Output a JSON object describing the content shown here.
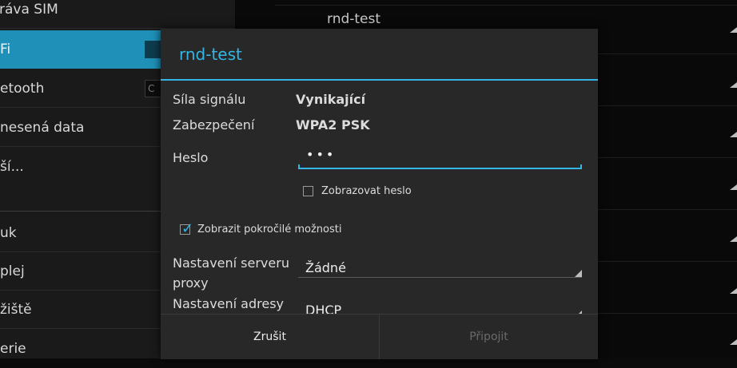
{
  "settings_list": {
    "items": [
      {
        "label": "ráva SIM",
        "toggle": ""
      },
      {
        "label": "Fi",
        "toggle": ""
      },
      {
        "label": "etooth",
        "toggle": "C"
      },
      {
        "label": "nesená data",
        "toggle": ""
      },
      {
        "label": "ší...",
        "toggle": ""
      },
      {
        "label": "uk",
        "toggle": ""
      },
      {
        "label": "plej",
        "toggle": ""
      },
      {
        "label": "žiště",
        "toggle": ""
      },
      {
        "label": "erie",
        "toggle": ""
      }
    ]
  },
  "wifi_list": {
    "network_name": "rnd-test"
  },
  "dialog": {
    "title": "rnd-test",
    "signal_label": "Síla signálu",
    "signal_value": "Vynikající",
    "security_label": "Zabezpečení",
    "security_value": "WPA2 PSK",
    "password_label": "Heslo",
    "password_value": "•••",
    "show_password_label": "Zobrazovat heslo",
    "show_password_checked": false,
    "advanced_label": "Zobrazit pokročilé možnosti",
    "advanced_checked": true,
    "proxy_label": "Nastavení serveru proxy",
    "proxy_value": "Žádné",
    "ip_label": "Nastavení adresy",
    "ip_value": "DHCP",
    "cancel_label": "Zrušit",
    "connect_label": "Připojit"
  },
  "colors": {
    "accent": "#33b5e5",
    "active_item": "#1f90b8",
    "dialog_bg": "#282828",
    "disabled_text": "#6a6a6a"
  }
}
